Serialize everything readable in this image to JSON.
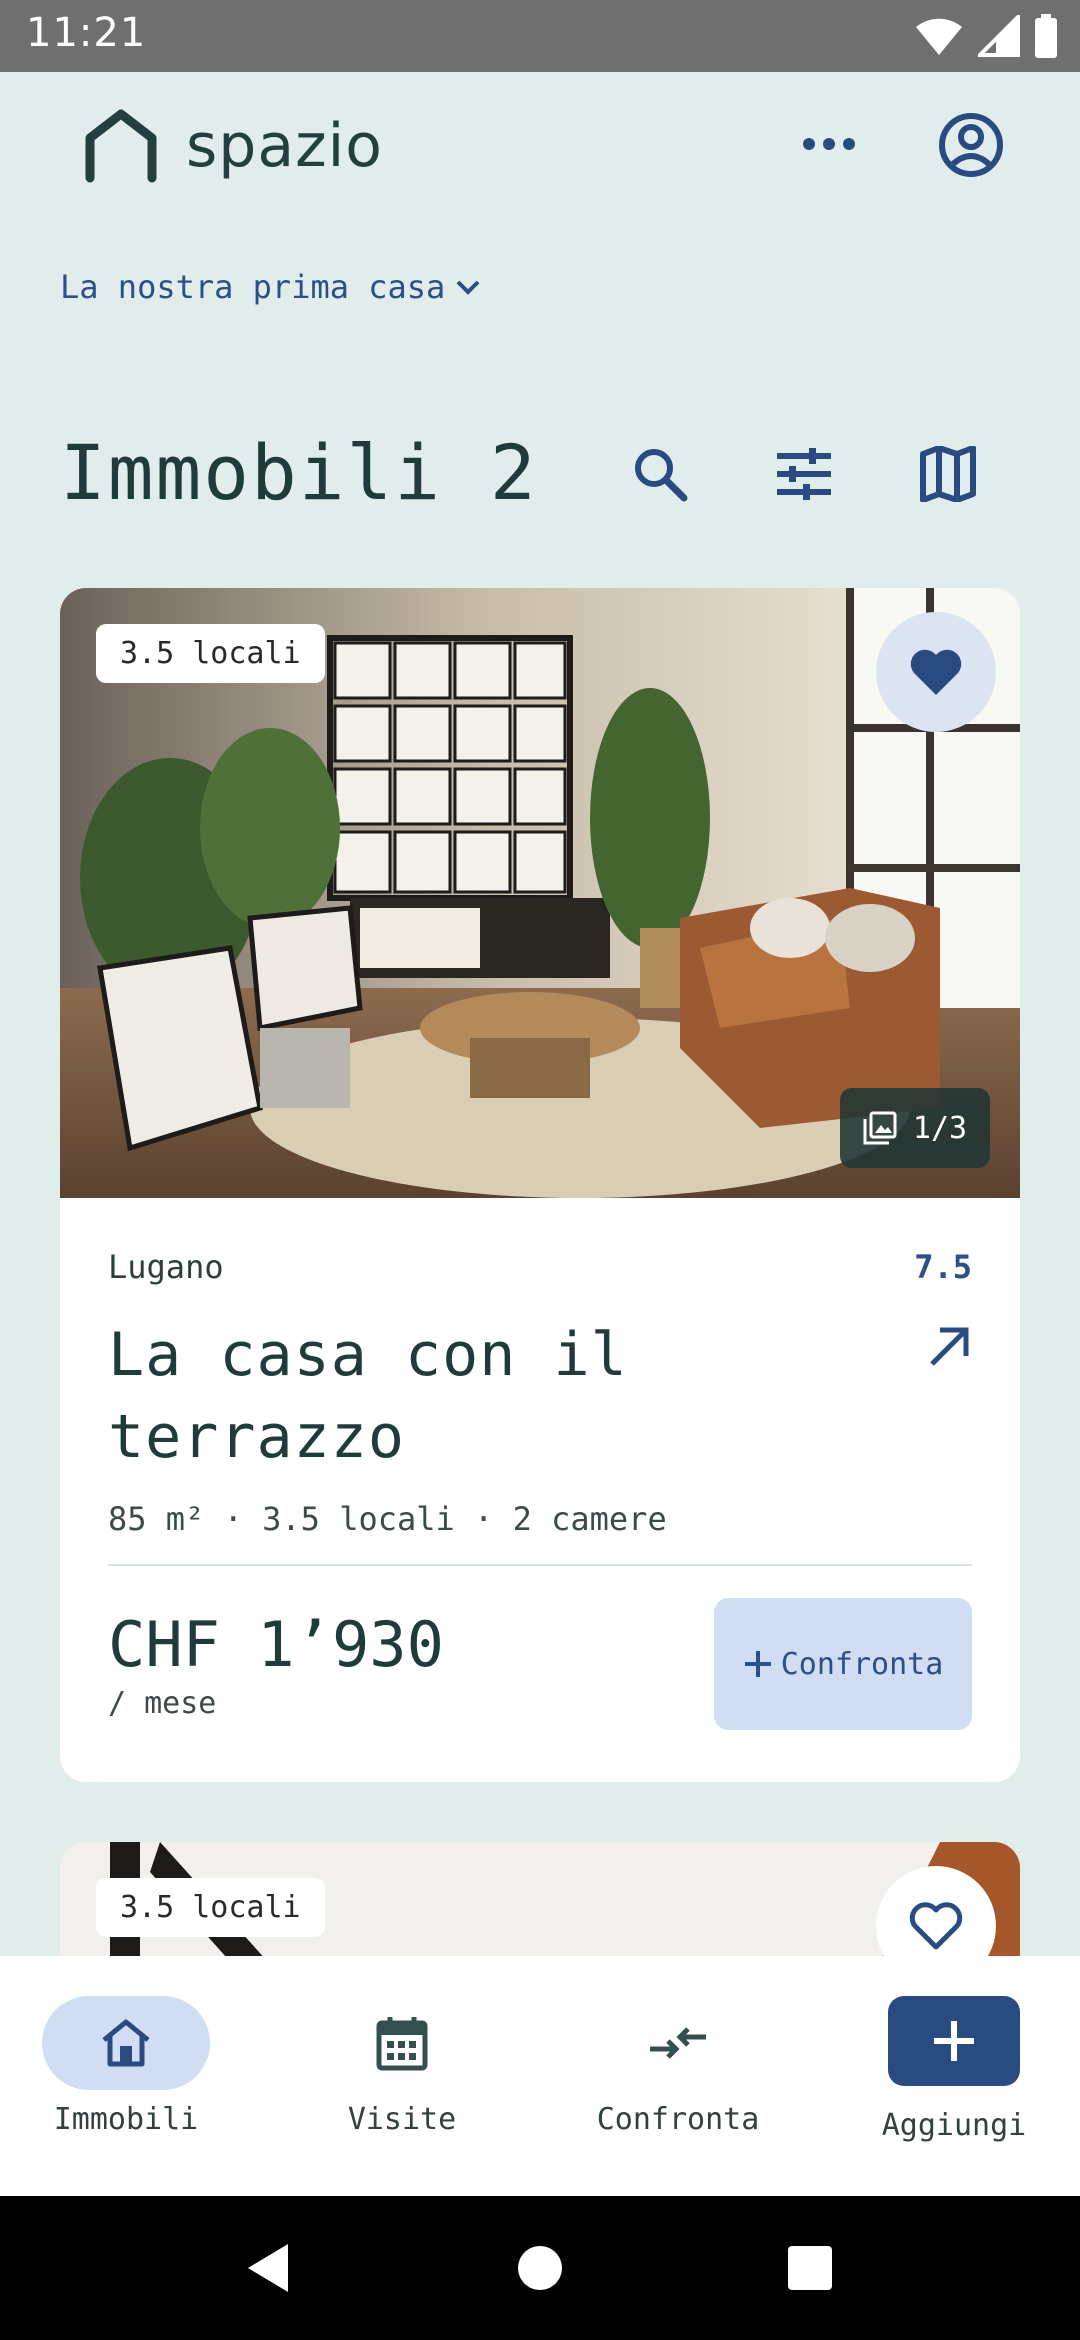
{
  "status_bar": {
    "time": "11:21",
    "icons": [
      "wifi-icon",
      "signal-icon",
      "battery-icon"
    ]
  },
  "header": {
    "app_name": "spazio",
    "logo_icon": "house-outline-icon",
    "more_icon": "more-horizontal-icon",
    "account_icon": "account-circle-icon"
  },
  "project": {
    "name": "La nostra prima casa"
  },
  "title": {
    "label": "Immobili",
    "count": "2"
  },
  "toolbar": {
    "icons": [
      "search-icon",
      "tune-icon",
      "map-icon"
    ]
  },
  "listings": [
    {
      "rooms_badge": "3.5 locali",
      "favorite": true,
      "photo_counter": "1/3",
      "city": "Lugano",
      "score": "7.5",
      "title": "La casa con il terrazzo",
      "specs": "85 m² · 3.5 locali · 2 camere",
      "price": "CHF 1’930",
      "period": "/ mese",
      "compare_label": "Confronta"
    },
    {
      "rooms_badge": "3.5 locali",
      "favorite": false
    }
  ],
  "bottom_nav": [
    {
      "label": "Immobili",
      "icon": "home-icon",
      "active": true
    },
    {
      "label": "Visite",
      "icon": "calendar-icon",
      "active": false
    },
    {
      "label": "Confronta",
      "icon": "compare-arrows-icon",
      "active": false
    },
    {
      "label": "Aggiungi",
      "icon": "plus-icon",
      "active": false
    }
  ],
  "colors": {
    "background": "#e1edeb",
    "accent": "#2b4f86",
    "primary_button": "#2a4a82",
    "active_pill": "#d0ddf2",
    "text_dark": "#1f3b3a"
  }
}
